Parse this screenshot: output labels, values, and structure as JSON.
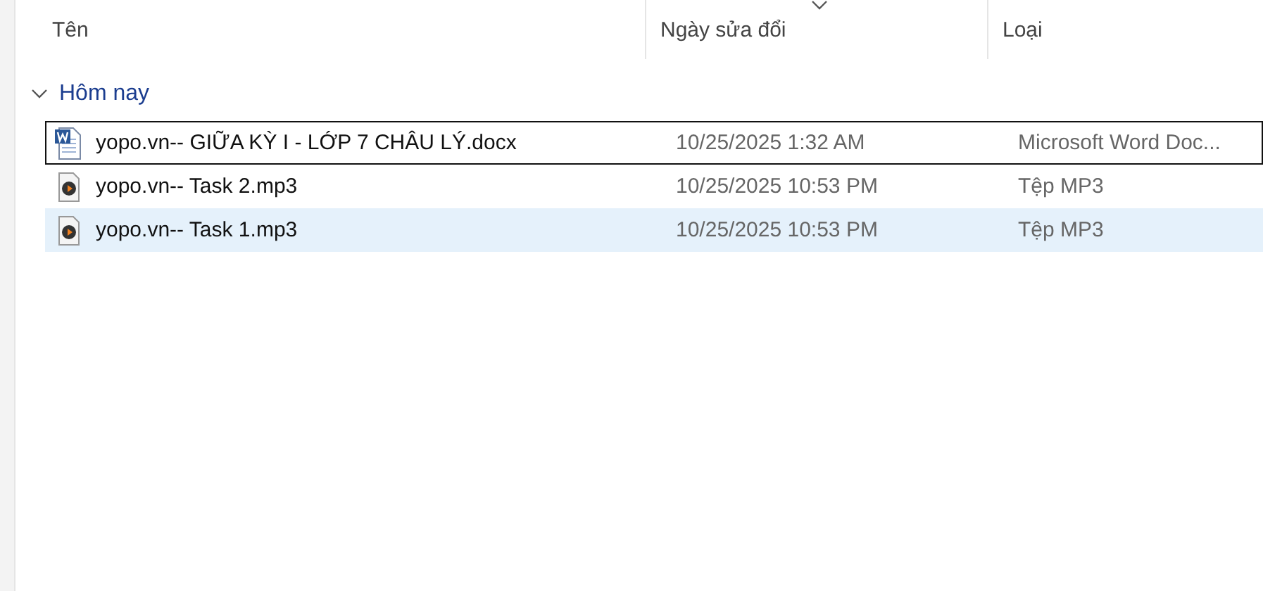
{
  "columns": [
    {
      "label": "Tên",
      "sorted": false
    },
    {
      "label": "Ngày sửa đổi",
      "sorted": true
    },
    {
      "label": "Loại",
      "sorted": false
    }
  ],
  "group": {
    "label": "Hôm nay",
    "expanded": true
  },
  "files": [
    {
      "kind": "docx",
      "name": "yopo.vn-- GIỮA KỲ I - LỚP 7 CHÂU LÝ.docx",
      "modified": "10/25/2025 1:32 AM",
      "type": "Microsoft Word Doc...",
      "focused": true,
      "selected": false
    },
    {
      "kind": "mp3",
      "name": "yopo.vn-- Task 2.mp3",
      "modified": "10/25/2025 10:53 PM",
      "type": "Tệp MP3",
      "focused": false,
      "selected": false
    },
    {
      "kind": "mp3",
      "name": "yopo.vn-- Task 1.mp3",
      "modified": "10/25/2025 10:53 PM",
      "type": "Tệp MP3",
      "focused": false,
      "selected": true
    }
  ]
}
